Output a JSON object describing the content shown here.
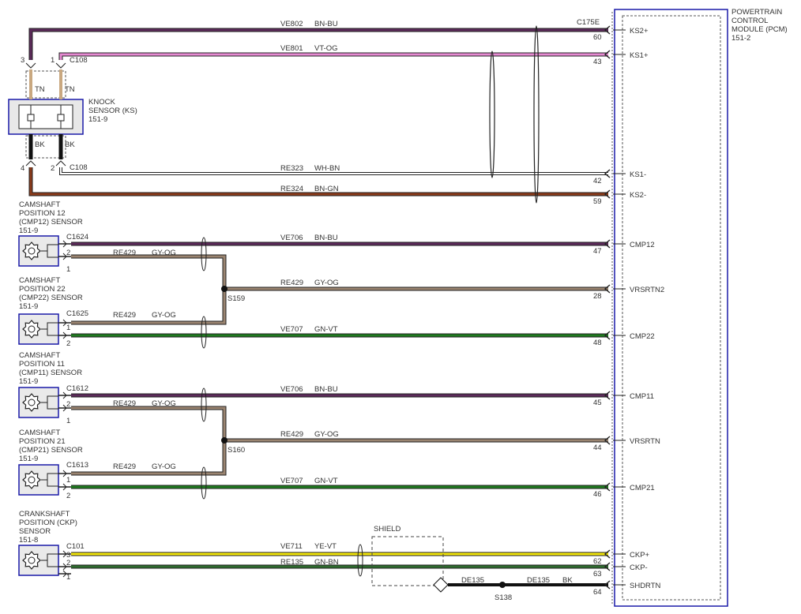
{
  "pcm": {
    "title_lines": [
      "POWERTRAIN",
      "CONTROL",
      "MODULE (PCM)",
      "151-2"
    ],
    "connector": "C175E"
  },
  "knock_sensor": {
    "title_lines": [
      "KNOCK",
      "SENSOR (KS)",
      "151-9"
    ],
    "connector_top": "C108",
    "connector_bottom": "C108",
    "pins": [
      "3",
      "1",
      "4",
      "2"
    ],
    "tn_label": "TN",
    "bk_label": "BK"
  },
  "wires": [
    {
      "id": "VE802",
      "color_name": "BN-BU",
      "pin": "60",
      "pcm_label": "KS2+",
      "color_hex": "#5c2a5a"
    },
    {
      "id": "VE801",
      "color_name": "VT-OG",
      "pin": "43",
      "pcm_label": "KS1+",
      "color_hex": "#e68ad2"
    },
    {
      "id": "RE323",
      "color_name": "WH-BN",
      "pin": "42",
      "pcm_label": "KS1-",
      "color_hex": "#ffffff"
    },
    {
      "id": "RE324",
      "color_name": "BN-GN",
      "pin": "59",
      "pcm_label": "KS2-",
      "color_hex": "#8b3a1a"
    },
    {
      "id": "VE706",
      "color_name": "BN-BU",
      "pin": "47",
      "pcm_label": "CMP12",
      "color_hex": "#5c2a5a"
    },
    {
      "id": "RE429",
      "color_name": "GY-OG",
      "pin": "28",
      "pcm_label": "VRSRTN2",
      "color_hex": "#9a8470"
    },
    {
      "id": "VE707",
      "color_name": "GN-VT",
      "pin": "48",
      "pcm_label": "CMP22",
      "color_hex": "#1f7a1f"
    },
    {
      "id": "VE706",
      "color_name": "BN-BU",
      "pin": "45",
      "pcm_label": "CMP11",
      "color_hex": "#5c2a5a"
    },
    {
      "id": "RE429",
      "color_name": "GY-OG",
      "pin": "44",
      "pcm_label": "VRSRTN",
      "color_hex": "#9a8470"
    },
    {
      "id": "VE707",
      "color_name": "GN-VT",
      "pin": "46",
      "pcm_label": "CMP21",
      "color_hex": "#1f7a1f"
    },
    {
      "id": "VE711",
      "color_name": "YE-VT",
      "pin": "62",
      "pcm_label": "CKP+",
      "color_hex": "#f2e60a"
    },
    {
      "id": "RE135",
      "color_name": "GN-BN",
      "pin": "63",
      "pcm_label": "CKP-",
      "color_hex": "#2e6b2e"
    },
    {
      "id": "DE135",
      "color_name": "BK",
      "pin": "64",
      "pcm_label": "SHDRTN",
      "color_hex": "#111111"
    }
  ],
  "sensors": [
    {
      "title_lines": [
        "CAMSHAFT",
        "POSITION 12",
        "(CMP12) SENSOR",
        "151-9"
      ],
      "connector": "C1624",
      "pins": [
        "2",
        "1"
      ],
      "branch_wire": "RE429",
      "branch_color": "GY-OG"
    },
    {
      "title_lines": [
        "CAMSHAFT",
        "POSITION 22",
        "(CMP22) SENSOR",
        "151-9"
      ],
      "connector": "C1625",
      "pins": [
        "1",
        "2"
      ],
      "branch_wire": "RE429",
      "branch_color": "GY-OG"
    },
    {
      "title_lines": [
        "CAMSHAFT",
        "POSITION 11",
        "(CMP11) SENSOR",
        "151-9"
      ],
      "connector": "C1612",
      "pins": [
        "2",
        "1"
      ],
      "branch_wire": "RE429",
      "branch_color": "GY-OG"
    },
    {
      "title_lines": [
        "CAMSHAFT",
        "POSITION 21",
        "(CMP21) SENSOR",
        "151-9"
      ],
      "connector": "C1613",
      "pins": [
        "1",
        "2"
      ],
      "branch_wire": "RE429",
      "branch_color": "GY-OG"
    },
    {
      "title_lines": [
        "CRANKSHAFT",
        "POSITION (CKP)",
        "SENSOR",
        "151-8"
      ],
      "connector": "C101",
      "pins": [
        "3",
        "2",
        "1"
      ]
    }
  ],
  "splices": [
    "S159",
    "S160",
    "S138"
  ],
  "shield": {
    "label": "SHIELD",
    "wire": "DE135"
  },
  "colors": {
    "module_border": "#1a1aa8",
    "dash": "#555555"
  }
}
